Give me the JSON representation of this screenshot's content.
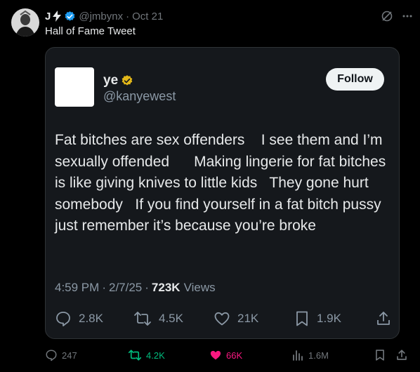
{
  "tweet": {
    "author_name": "J",
    "handle": "@jmbynx",
    "separator": "·",
    "date": "Oct 21",
    "text": "Hall of Fame Tweet"
  },
  "quoted": {
    "name": "ye",
    "handle": "@kanyewest",
    "follow_label": "Follow",
    "body": "Fat bitches are sex offenders    I see them and I’m sexually offended      Making lingerie for fat bitches is like giving knives to little kids   They gone hurt somebody   If you find yourself in a fat bitch pussy just remember it’s because you’re broke",
    "time": "4:59 PM",
    "sep1": "·",
    "date": "2/7/25",
    "sep2": "·",
    "views_count": "723K",
    "views_label": "Views",
    "replies": "2.8K",
    "reposts": "4.5K",
    "likes": "21K",
    "bookmarks": "1.9K"
  },
  "actions": {
    "replies": "247",
    "reposts": "4.2K",
    "likes": "66K",
    "views": "1.6M"
  },
  "colors": {
    "background": "#000000",
    "card": "#15181c",
    "muted": "#71767b",
    "verified_blue": "#1d9bf0",
    "verified_gold": "#e2b719",
    "repost_green": "#00ba7c",
    "like_pink": "#f91880"
  },
  "icons": [
    "lightning-icon",
    "verified-badge-icon",
    "grok-icon",
    "more-icon",
    "gold-verified-icon",
    "reply-icon",
    "repost-icon",
    "like-icon",
    "bookmark-icon",
    "share-icon",
    "views-icon"
  ]
}
